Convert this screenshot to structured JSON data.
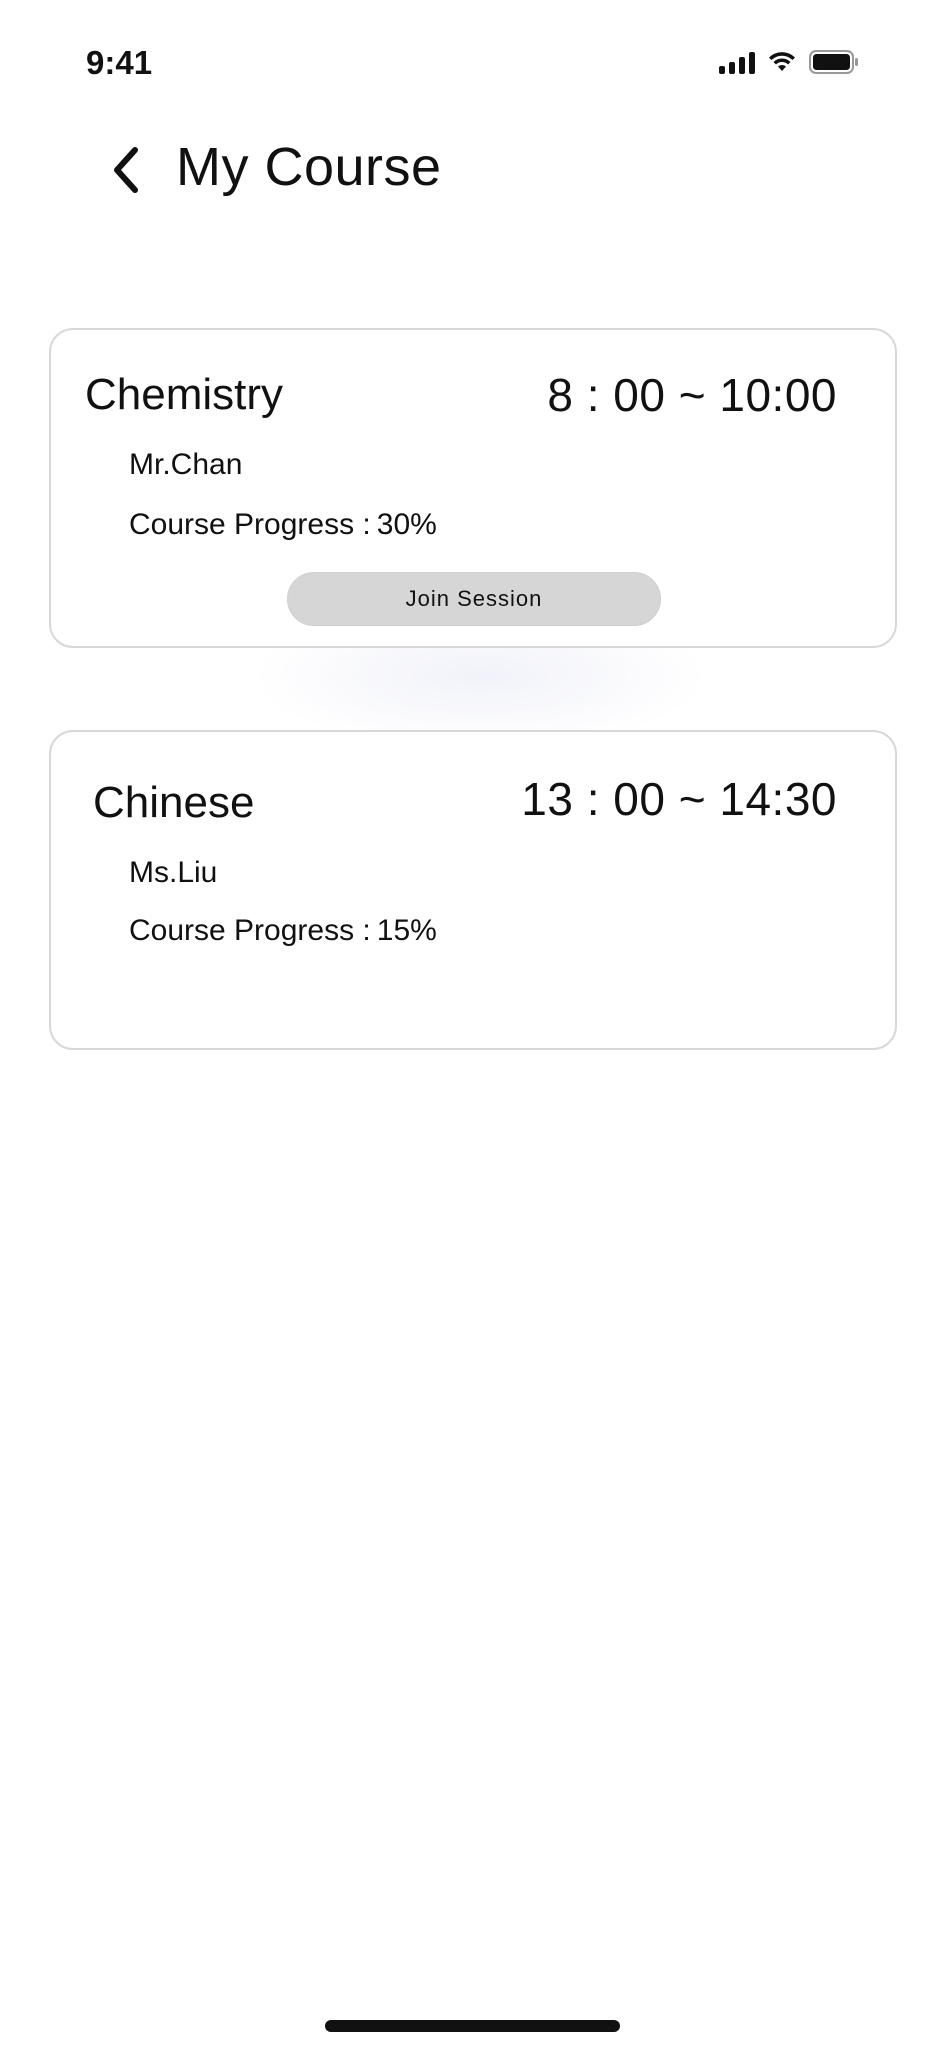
{
  "status_bar": {
    "time": "9:41",
    "icons": [
      "signal-icon",
      "wifi-icon",
      "battery-icon"
    ]
  },
  "header": {
    "back_icon": "chevron-left-icon",
    "title": "My Course"
  },
  "courses": [
    {
      "name": "Chemistry",
      "time": "8 : 00 ~ 10:00",
      "teacher": "Mr.Chan",
      "progress_label": "Course Progress :",
      "progress_value": "30%",
      "button_label": "Join Session"
    },
    {
      "name": "Chinese",
      "time": "13 : 00 ~ 14:30",
      "teacher": "Ms.Liu",
      "progress_label": "Course Progress :",
      "progress_value": "15%"
    }
  ],
  "colors": {
    "text": "#111111",
    "card_border": "#d8d8d8",
    "button_bg": "#d6d6d6",
    "background": "#ffffff"
  }
}
